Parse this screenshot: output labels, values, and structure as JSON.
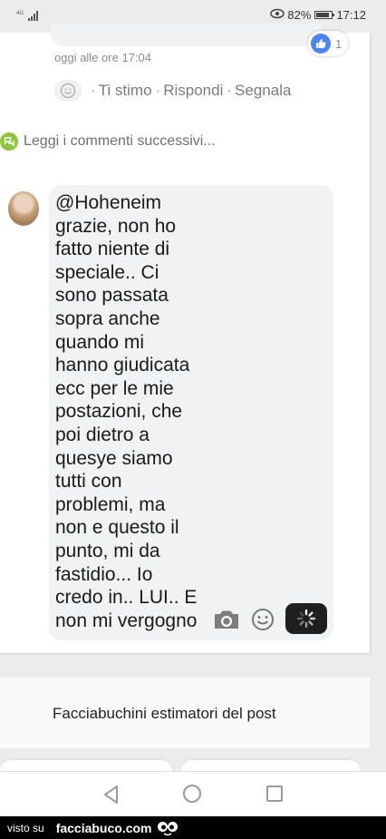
{
  "status_bar": {
    "network": "4G",
    "battery": "82%",
    "time": "17:12",
    "icons": [
      "signal-icon",
      "eye-icon",
      "battery-icon"
    ]
  },
  "previous_comment": {
    "like_count": "1",
    "timestamp": "oggi alle ore 17:04",
    "actions": {
      "ti_stimo": "Ti stimo",
      "rispondi": "Rispondi",
      "segnala": "Segnala"
    }
  },
  "more_comments_label": "Leggi i commenti successivi...",
  "compose": {
    "text": "@Hoheneim\ngrazie, non ho\nfatto niente di\nspeciale.. Ci\nsono passata\nsopra anche\nquando mi\nhanno giudicata\necc per le mie\npostazioni, che\npoi dietro a\nquesye siamo\ntutti con\nproblemi, ma\nnon e questo il\npunto, mi da\nfastidio... Io\ncredo in.. LUI.. E\nnon mi vergogno"
  },
  "estimators_title": "Facciabuchini estimatori del post",
  "watermark": {
    "prefix": "visto su",
    "site": "facciabuco.com"
  },
  "colors": {
    "like_blue": "#4c84f0",
    "more_green": "#8fc43f",
    "bubble_gray": "#f1f2f4",
    "send_dark": "#1f1f1f"
  }
}
